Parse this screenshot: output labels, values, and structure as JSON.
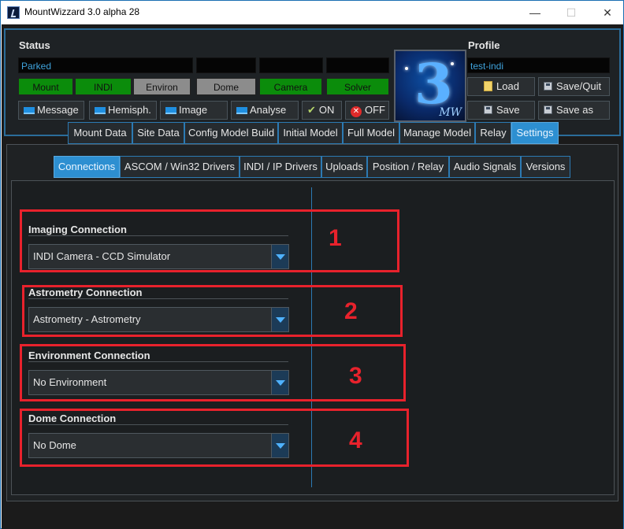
{
  "window": {
    "title": "MountWizzard 3.0 alpha 28"
  },
  "status": {
    "heading": "Status",
    "state": "Parked",
    "indicators": [
      {
        "label": "Mount",
        "color": "#0b8c0b"
      },
      {
        "label": "INDI",
        "color": "#0b8c0b"
      },
      {
        "label": "Environ",
        "color": "#8c8c8c"
      },
      {
        "label": "Dome",
        "color": "#8c8c8c"
      },
      {
        "label": "Camera",
        "color": "#0b8c0b"
      },
      {
        "label": "Solver",
        "color": "#0b8c0b"
      }
    ],
    "buttons": {
      "message": "Message",
      "hemisph": "Hemisph.",
      "image": "Image",
      "analyse": "Analyse",
      "on": "ON",
      "off": "OFF"
    }
  },
  "logo": {
    "mark": "3",
    "sub": "MW"
  },
  "profile": {
    "heading": "Profile",
    "name": "test-indi",
    "load": "Load",
    "save_quit": "Save/Quit",
    "save": "Save",
    "save_as": "Save as"
  },
  "main_tabs": [
    "Mount Data",
    "Site Data",
    "Config Model Build",
    "Initial Model",
    "Full Model",
    "Manage Model",
    "Relay",
    "Settings"
  ],
  "sub_tabs": [
    "Connections",
    "ASCOM / Win32 Drivers",
    "INDI / IP Drivers",
    "Uploads",
    "Position / Relay",
    "Audio Signals",
    "Versions"
  ],
  "connections": [
    {
      "title": "Imaging Connection",
      "value": "INDI Camera - CCD Simulator",
      "marker": "1"
    },
    {
      "title": "Astrometry Connection",
      "value": "Astrometry - Astrometry",
      "marker": "2"
    },
    {
      "title": "Environment Connection",
      "value": "No Environment",
      "marker": "3"
    },
    {
      "title": "Dome Connection",
      "value": "No Dome",
      "marker": "4"
    }
  ],
  "colors": {
    "accent": "#2d8fd1",
    "status_green": "#0b8c0b",
    "status_grey": "#8c8c8c",
    "annotation_red": "#e8222c"
  }
}
